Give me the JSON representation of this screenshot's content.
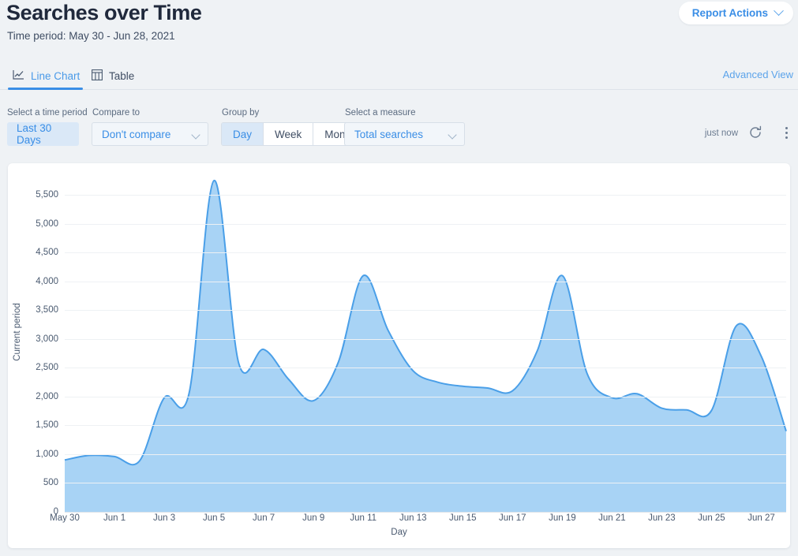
{
  "header": {
    "title": "Searches over Time",
    "subtitle": "Time period: May 30 - Jun 28, 2021",
    "report_actions_label": "Report Actions"
  },
  "tabs": {
    "line_chart_label": "Line Chart",
    "table_label": "Table",
    "advanced_view_label": "Advanced View",
    "active": "Line Chart"
  },
  "controls": {
    "time_period_label": "Select a time period",
    "time_period_value": "Last 30 Days",
    "compare_label": "Compare to",
    "compare_value": "Don't compare",
    "group_by_label": "Group by",
    "group_by_options": [
      "Day",
      "Week",
      "Month"
    ],
    "group_by_selected": "Day",
    "measure_label": "Select a measure",
    "measure_value": "Total searches",
    "last_updated": "just now",
    "refresh_icon": "refresh-icon",
    "more_icon": "kebab-menu-icon"
  },
  "colors": {
    "accent": "#3a8ee6",
    "link": "#5ba3ea",
    "line": "#4a9fe8",
    "area_fill": "#a8d3f5",
    "page_bg": "#eff2f5",
    "card_bg": "#ffffff",
    "text": "#3f4d63",
    "title": "#20293c"
  },
  "chart_data": {
    "type": "area",
    "title": "Searches over Time",
    "xlabel": "Day",
    "ylabel": "Current period",
    "ylim": [
      0,
      5750
    ],
    "yticks": [
      0,
      500,
      1000,
      1500,
      2000,
      2500,
      3000,
      3500,
      4000,
      4500,
      5000,
      5500
    ],
    "ytick_labels": [
      "0",
      "500",
      "1,000",
      "1,500",
      "2,000",
      "2,500",
      "3,000",
      "3,500",
      "4,000",
      "4,500",
      "5,000",
      "5,500"
    ],
    "xtick_labels": [
      "May 30",
      "Jun 1",
      "Jun 3",
      "Jun 5",
      "Jun 7",
      "Jun 9",
      "Jun 11",
      "Jun 13",
      "Jun 15",
      "Jun 17",
      "Jun 19",
      "Jun 21",
      "Jun 23",
      "Jun 25",
      "Jun 27"
    ],
    "grid": true,
    "legend": false,
    "x": [
      "May 30",
      "May 31",
      "Jun 1",
      "Jun 2",
      "Jun 3",
      "Jun 4",
      "Jun 5",
      "Jun 6",
      "Jun 7",
      "Jun 8",
      "Jun 9",
      "Jun 10",
      "Jun 11",
      "Jun 12",
      "Jun 13",
      "Jun 14",
      "Jun 15",
      "Jun 16",
      "Jun 17",
      "Jun 18",
      "Jun 19",
      "Jun 20",
      "Jun 21",
      "Jun 22",
      "Jun 23",
      "Jun 24",
      "Jun 25",
      "Jun 26",
      "Jun 27",
      "Jun 28"
    ],
    "series": [
      {
        "name": "Current period",
        "values": [
          900,
          980,
          960,
          880,
          1980,
          2060,
          5750,
          2570,
          2820,
          2300,
          1930,
          2600,
          4100,
          3150,
          2450,
          2250,
          2180,
          2150,
          2100,
          2800,
          4100,
          2400,
          1980,
          2050,
          1800,
          1770,
          1760,
          3230,
          2700,
          1400
        ]
      }
    ]
  }
}
